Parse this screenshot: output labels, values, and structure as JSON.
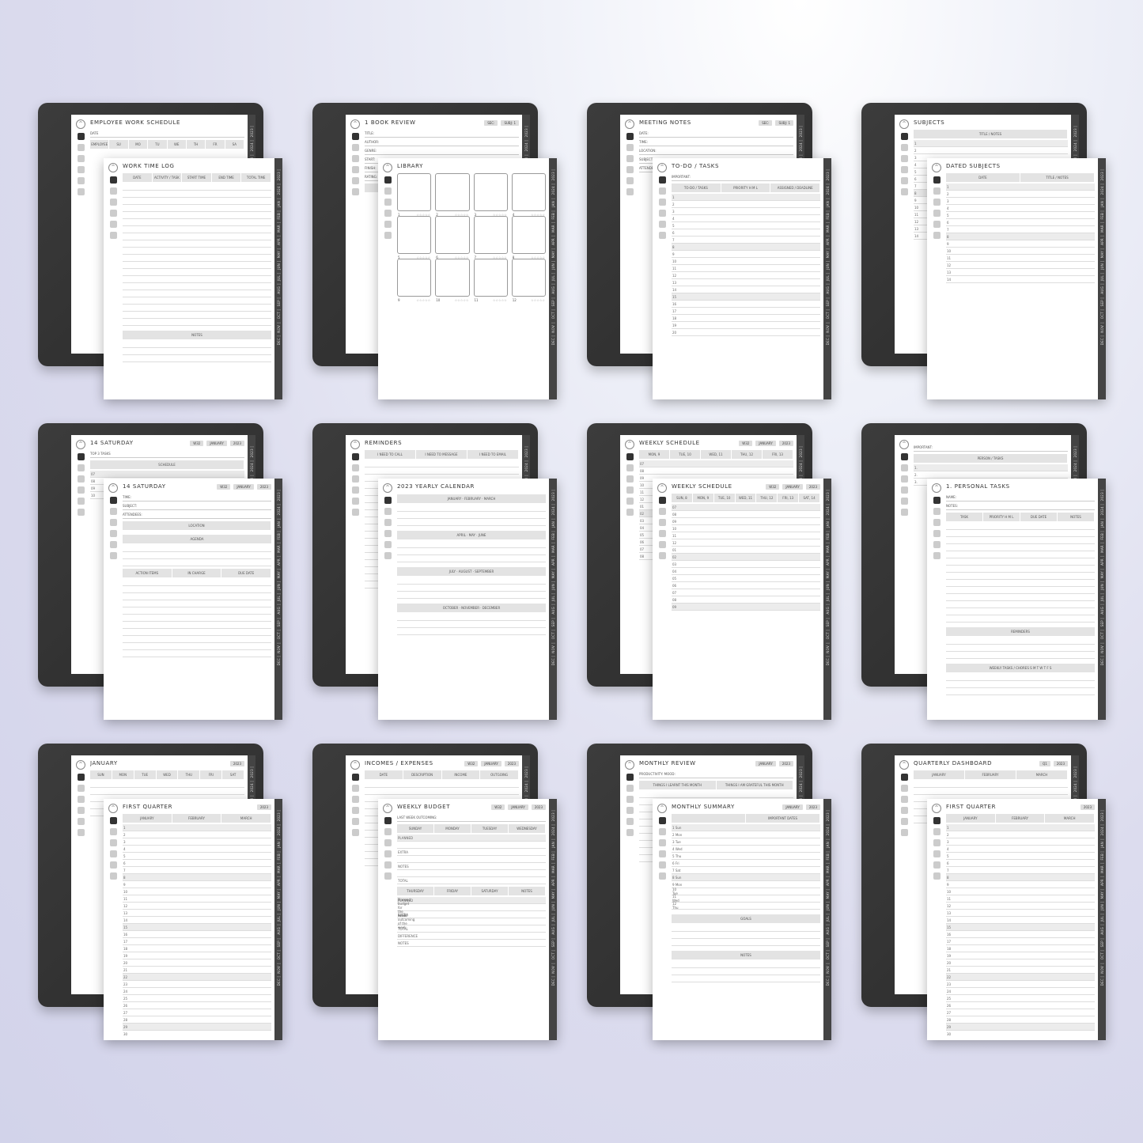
{
  "side_tabs": [
    "2023",
    "2024",
    "JAN",
    "FEB",
    "MAR",
    "APR",
    "MAY",
    "JUN",
    "JUL",
    "AUG",
    "SEP",
    "OCT",
    "NOV",
    "DEC"
  ],
  "cards": [
    {
      "back": {
        "title": "EMPLOYEE WORK SCHEDULE",
        "chips": [],
        "fields": [
          "DATE"
        ],
        "columns": [
          "EMPLOYEE",
          "SU",
          "MO",
          "TU",
          "WE",
          "TH",
          "FR",
          "SA"
        ],
        "rows": [],
        "sections": []
      },
      "front": {
        "title": "WORK TIME LOG",
        "chips": [],
        "fields": [],
        "columns": [
          "DATE",
          "ACTIVITY / TASK",
          "START TIME",
          "END TIME",
          "TOTAL TIME"
        ],
        "rows": [
          "",
          "",
          "",
          "",
          "",
          "",
          "",
          "",
          "",
          "",
          "",
          "",
          "",
          "",
          "",
          "",
          "",
          "",
          "",
          ""
        ],
        "sections": [
          "NOTES"
        ]
      }
    },
    {
      "back": {
        "title": "1 BOOK REVIEW",
        "chips": [
          "SEC:",
          "SUBJ: 1"
        ],
        "fields": [
          "TITLE:",
          "AUTHOR:",
          "GENRE:",
          "START:",
          "FINISH:",
          "RATING:"
        ],
        "columns": [
          "SUMMARY / THOUGHTS"
        ],
        "rows": [],
        "sections": []
      },
      "front": {
        "title": "LIBRARY",
        "chips": [],
        "fields": [],
        "columns": [],
        "rows": [],
        "sections": [],
        "boxes": [
          "1",
          "2",
          "3",
          "4",
          "5",
          "6",
          "7",
          "8",
          "9",
          "10",
          "11",
          "12"
        ],
        "stars": "☆☆☆☆☆"
      }
    },
    {
      "back": {
        "title": "MEETING NOTES",
        "chips": [
          "SEC:",
          "SUBJ: 1"
        ],
        "fields": [
          "DATE:",
          "TIME:",
          "LOCATION:",
          "SUBJECT:",
          "ATTENDEES:"
        ],
        "columns": [],
        "rows": [],
        "sections": []
      },
      "front": {
        "title": "TO-DO / TASKS",
        "chips": [],
        "fields": [
          "IMPORTANT:"
        ],
        "columns": [
          "TO-DO / TASKS",
          "PRIORITY H M L",
          "ASSIGNED / DEADLINE"
        ],
        "rows": [
          "1",
          "2",
          "3",
          "4",
          "5",
          "6",
          "7",
          "8",
          "9",
          "10",
          "11",
          "12",
          "13",
          "14",
          "15",
          "16",
          "17",
          "18",
          "19",
          "20"
        ],
        "sections": []
      }
    },
    {
      "back": {
        "title": "SUBJECTS",
        "chips": [],
        "fields": [],
        "columns": [
          "TITLE / NOTES"
        ],
        "rows": [
          "1",
          "2",
          "3",
          "4",
          "5",
          "6",
          "7",
          "8",
          "9",
          "10",
          "11",
          "12",
          "13",
          "14"
        ],
        "sections": []
      },
      "front": {
        "title": "DATED SUBJECTS",
        "chips": [],
        "fields": [],
        "columns": [
          "DATE",
          "TITLE / NOTES"
        ],
        "rows": [
          "1",
          "2",
          "3",
          "4",
          "5",
          "6",
          "7",
          "8",
          "9",
          "10",
          "11",
          "12",
          "13",
          "14"
        ],
        "sections": []
      }
    },
    {
      "back": {
        "title": "14 SATURDAY",
        "chips": [
          "W32",
          "JANUARY",
          "2023"
        ],
        "fields": [
          "TOP 3 TASKS"
        ],
        "columns": [
          "SCHEDULE"
        ],
        "rows": [
          "07",
          "08",
          "09",
          "10"
        ],
        "sections": []
      },
      "front": {
        "title": "14 SATURDAY",
        "chips": [
          "W32",
          "JANUARY",
          "2023"
        ],
        "fields": [
          "TIME:",
          "SUBJECT:",
          "ATTENDEES:"
        ],
        "columns": [
          "LOCATION"
        ],
        "rows": [],
        "sections": [
          "AGENDA"
        ],
        "extra_columns": [
          "ACTION ITEMS",
          "IN CHARGE",
          "DUE DATE"
        ],
        "extra_rows": [
          "",
          "",
          "",
          "",
          "",
          "",
          "",
          "",
          "",
          "",
          ""
        ]
      }
    },
    {
      "back": {
        "title": "REMINDERS",
        "chips": [],
        "fields": [],
        "columns": [
          "I NEED TO CALL",
          "I NEED TO MESSAGE",
          "I NEED TO EMAIL"
        ],
        "rows": [
          "",
          "",
          "",
          "",
          "",
          "",
          "",
          "",
          "",
          "",
          "",
          "",
          "",
          "",
          "",
          "",
          "",
          ""
        ],
        "sections": []
      },
      "front": {
        "title": "2023 YEARLY CALENDAR",
        "chips": [],
        "fields": [],
        "columns": [],
        "rows": [],
        "sections": [
          "JANUARY · FEBRUARY · MARCH",
          "APRIL · MAY · JUNE",
          "JULY · AUGUST · SEPTEMBER",
          "OCTOBER · NOVEMBER · DECEMBER"
        ]
      }
    },
    {
      "back": {
        "title": "WEEKLY SCHEDULE",
        "chips": [
          "W32",
          "JANUARY",
          "2023"
        ],
        "fields": [],
        "columns": [
          "MON, 9",
          "TUE, 10",
          "WED, 11",
          "THU, 12",
          "FRI, 13"
        ],
        "rows": [
          "07",
          "08",
          "09",
          "10",
          "11",
          "12",
          "01",
          "02",
          "03",
          "04",
          "05",
          "06",
          "07",
          "08"
        ],
        "sections": []
      },
      "front": {
        "title": "WEEKLY SCHEDULE",
        "chips": [
          "W32",
          "JANUARY",
          "2023"
        ],
        "fields": [],
        "columns": [
          "SUN, 8",
          "MON, 9",
          "TUE, 10",
          "WED, 11",
          "THU, 12",
          "FRI, 13",
          "SAT, 14"
        ],
        "rows": [
          "07",
          "08",
          "09",
          "10",
          "11",
          "12",
          "01",
          "02",
          "03",
          "04",
          "05",
          "06",
          "07",
          "08",
          "09"
        ],
        "sections": []
      }
    },
    {
      "back": {
        "title": "",
        "chips": [],
        "fields": [
          "IMPORTANT:"
        ],
        "columns": [
          "PERSON / TASKS"
        ],
        "rows": [
          "1.",
          "2.",
          "3."
        ],
        "sections": []
      },
      "front": {
        "title": "1. PERSONAL TASKS",
        "chips": [],
        "fields": [
          "NAME:",
          "NOTES:"
        ],
        "columns": [
          "TASK",
          "PRIORITY H M L",
          "DUE DATE",
          "NOTES"
        ],
        "rows": [
          "",
          "",
          "",
          "",
          "",
          "",
          "",
          "",
          "",
          "",
          "",
          "",
          "",
          ""
        ],
        "sections": [
          "REMINDERS",
          "WEEKLY TASKS / CHORES  S M T W T F S"
        ]
      }
    },
    {
      "back": {
        "title": "JANUARY",
        "chips": [
          "2023"
        ],
        "fields": [],
        "columns": [
          "SUN",
          "MON",
          "TUE",
          "WED",
          "THU",
          "FRI",
          "SAT"
        ],
        "rows": [
          "",
          "",
          "",
          "",
          ""
        ],
        "sections": []
      },
      "front": {
        "title": "FIRST QUARTER",
        "chips": [
          "2023"
        ],
        "fields": [],
        "columns": [
          "JANUARY",
          "FEBRUARY",
          "MARCH"
        ],
        "rows": [
          "1",
          "2",
          "3",
          "4",
          "5",
          "6",
          "7",
          "8",
          "9",
          "10",
          "11",
          "12",
          "13",
          "14",
          "15",
          "16",
          "17",
          "18",
          "19",
          "20",
          "21",
          "22",
          "23",
          "24",
          "25",
          "26",
          "27",
          "28",
          "29",
          "30",
          "31"
        ],
        "sections": []
      }
    },
    {
      "back": {
        "title": "INCOMES / EXPENSES",
        "chips": [
          "W32",
          "JANUARY",
          "2023"
        ],
        "fields": [],
        "columns": [
          "DATE",
          "DESCRIPTION",
          "INCOME",
          "OUTGOING"
        ],
        "rows": [
          "",
          "",
          "",
          "",
          "",
          "",
          "",
          "",
          "",
          "",
          "",
          ""
        ],
        "sections": []
      },
      "front": {
        "title": "WEEKLY BUDGET",
        "chips": [
          "W32",
          "JANUARY",
          "2023"
        ],
        "fields": [
          "LAST WEEK OUTCOMING:"
        ],
        "columns": [
          "SUNDAY",
          "MONDAY",
          "TUESDAY",
          "WEDNESDAY"
        ],
        "rows": [
          "PLANNED",
          "",
          "EXTRA",
          "",
          "NOTES",
          "",
          "TOTAL"
        ],
        "sections": [],
        "extra_columns": [
          "THURSDAY",
          "FRIDAY",
          "SATURDAY",
          "NOTES"
        ],
        "extra_rows": [
          "PLANNED",
          "Planned budget for the week",
          "EXTRA",
          "Actual outcoming of the week",
          "TOTAL",
          "DIFFERENCE",
          "NOTES"
        ]
      }
    },
    {
      "back": {
        "title": "MONTHLY REVIEW",
        "chips": [
          "JANUARY",
          "2023"
        ],
        "fields": [
          "PRODUCTIVITY:   MOOD:"
        ],
        "columns": [
          "THINGS I LEARNT THIS MONTH",
          "THINGS I AM GRATEFUL THIS MONTH"
        ],
        "rows": [
          "",
          "",
          "",
          "",
          "",
          "",
          "",
          "",
          "",
          ""
        ],
        "sections": []
      },
      "front": {
        "title": "MONTHLY SUMMARY",
        "chips": [
          "JANUARY",
          "2023"
        ],
        "fields": [],
        "columns": [
          "",
          "IMPORTANT DATES"
        ],
        "rows": [
          "1 Sun",
          "2 Mon",
          "3 Tue",
          "4 Wed",
          "5 Thu",
          "6 Fri",
          "7 Sat",
          "8 Sun",
          "9 Mon",
          "10 Tue",
          "11 Wed",
          "12 Thu"
        ],
        "sections": [
          "GOALS",
          "NOTES"
        ]
      }
    },
    {
      "back": {
        "title": "QUARTERLY DASHBOARD",
        "chips": [
          "Q1",
          "2023"
        ],
        "fields": [],
        "columns": [
          "JANUARY",
          "FEBRUARY",
          "MARCH"
        ],
        "rows": [
          "",
          "",
          "",
          "",
          "",
          ""
        ],
        "sections": []
      },
      "front": {
        "title": "FIRST QUARTER",
        "chips": [
          "2023"
        ],
        "fields": [],
        "columns": [
          "JANUARY",
          "FEBRUARY",
          "MARCH"
        ],
        "rows": [
          "1",
          "2",
          "3",
          "4",
          "5",
          "6",
          "7",
          "8",
          "9",
          "10",
          "11",
          "12",
          "13",
          "14",
          "15",
          "16",
          "17",
          "18",
          "19",
          "20",
          "21",
          "22",
          "23",
          "24",
          "25",
          "26",
          "27",
          "28",
          "29",
          "30",
          "31"
        ],
        "sections": []
      }
    }
  ]
}
